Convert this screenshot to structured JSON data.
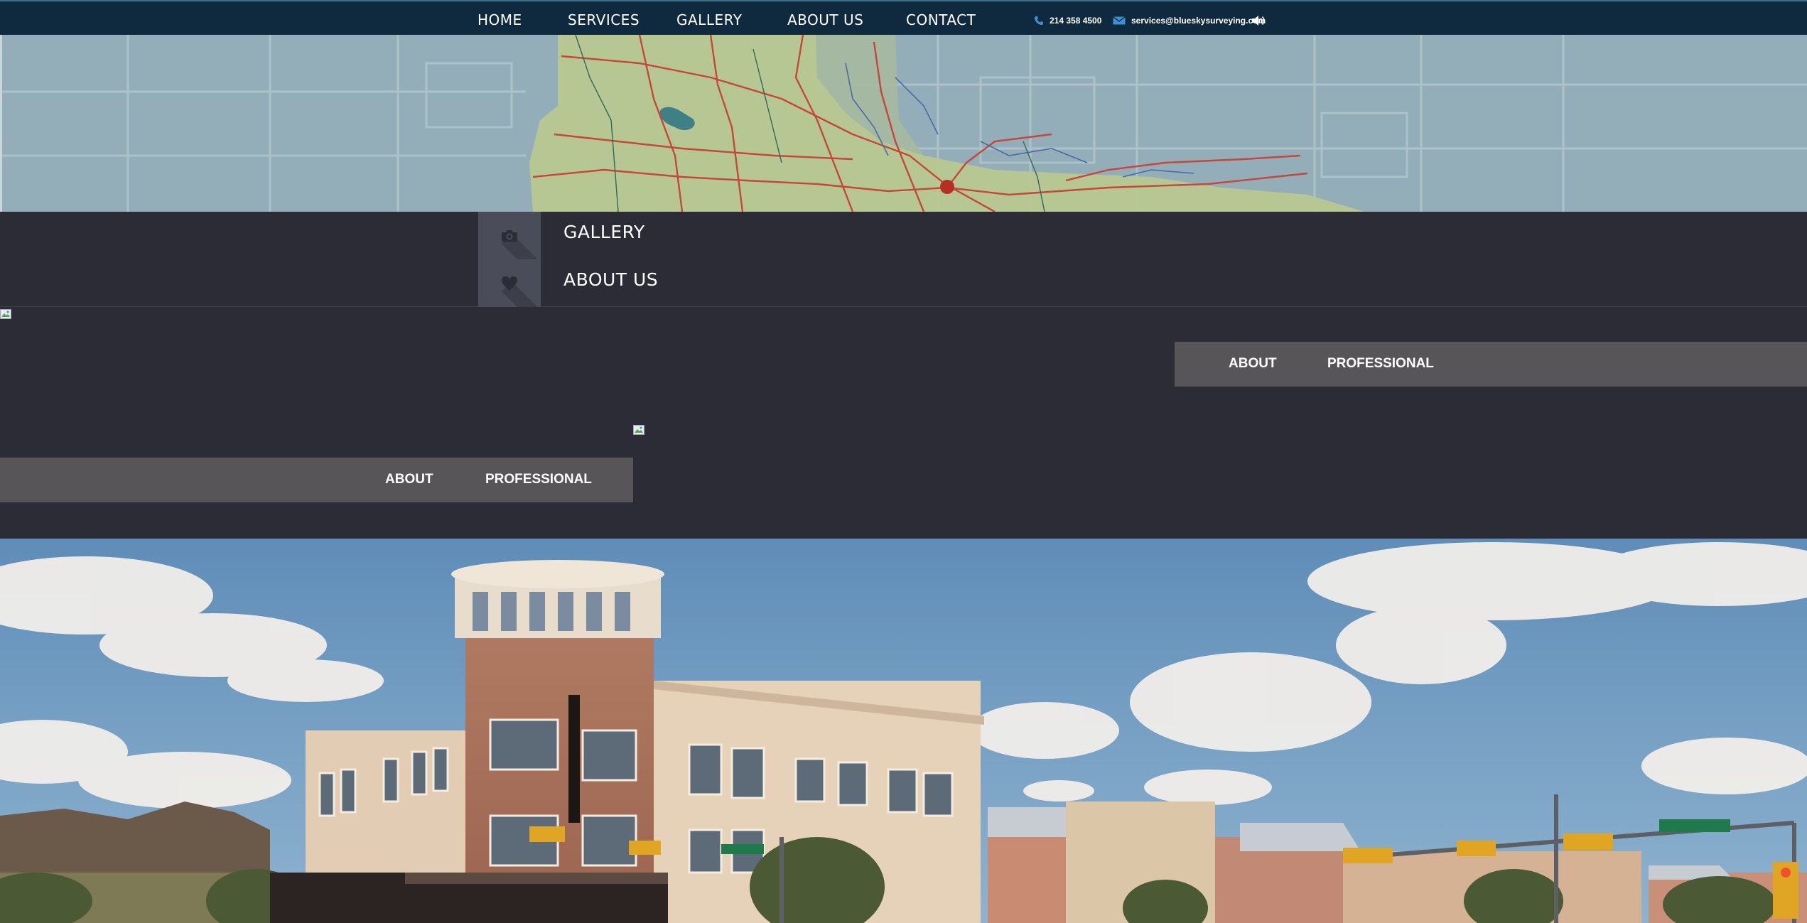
{
  "nav": {
    "items": [
      {
        "label": "HOME"
      },
      {
        "label": "SERVICES"
      },
      {
        "label": "GALLERY"
      },
      {
        "label": "ABOUT US"
      },
      {
        "label": "CONTACT"
      }
    ],
    "phone": "214 358 4500",
    "email": "services@blueskysurveying.com",
    "icons": {
      "phone": "phone-icon",
      "email": "envelope-icon",
      "sound": "speaker-icon"
    }
  },
  "strip": {
    "items": [
      {
        "label": "GALLERY",
        "icon": "camera-icon"
      },
      {
        "label": "ABOUT US",
        "icon": "heart-icon"
      }
    ]
  },
  "section1": {
    "tabs": [
      {
        "label": "ABOUT"
      },
      {
        "label": "PROFESSIONAL"
      }
    ]
  },
  "section2": {
    "tabs": [
      {
        "label": "ABOUT"
      },
      {
        "label": "PROFESSIONAL"
      }
    ]
  },
  "colors": {
    "nav_bg": "#0f2a3e",
    "page_bg": "#2b2c35",
    "tab_bg": "#575557",
    "icon_col": "#4a4c5a"
  }
}
